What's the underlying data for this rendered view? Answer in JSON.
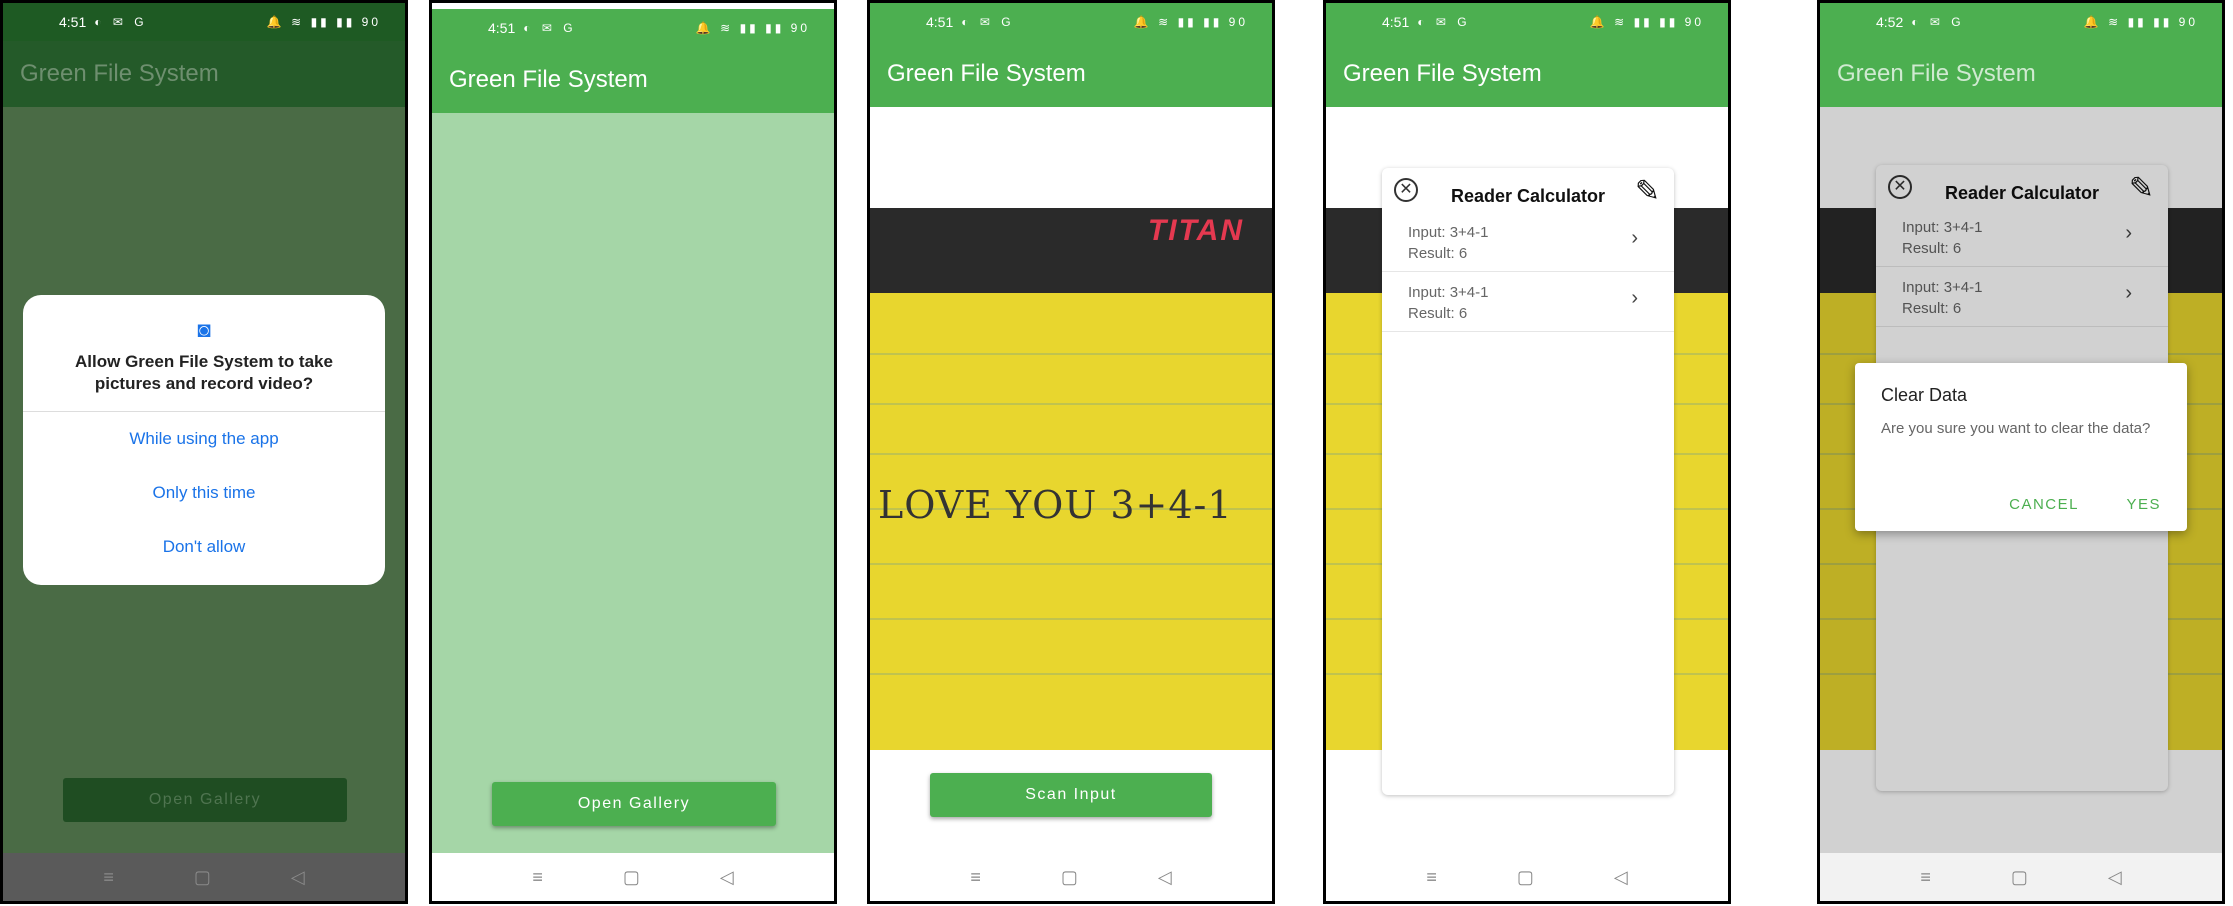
{
  "app_title": "Green File System",
  "screens": [
    {
      "status": {
        "time": "4:51",
        "icons": "◐ ✉ G",
        "right": "🔔 ≋ ▮▮ ▮▮ 90"
      },
      "permission": {
        "question": "Allow Green File System to take pictures and record video?",
        "options": [
          "While using the app",
          "Only this time",
          "Don't allow"
        ]
      },
      "button_label": "Open Gallery"
    },
    {
      "status": {
        "time": "4:51",
        "icons": "◐ ✉ G",
        "right": "🔔 ≋ ▮▮ ▮▮ 90"
      },
      "button_label": "Open Gallery"
    },
    {
      "status": {
        "time": "4:51",
        "icons": "◐ ✉ G",
        "right": "🔔 ≋ ▮▮ ▮▮ 90"
      },
      "photo": {
        "brand": "TITAN",
        "handwriting": "LOVE YOU 3+4-1"
      },
      "button_label": "Scan Input"
    },
    {
      "status": {
        "time": "4:51",
        "icons": "◐ ✉ G",
        "right": "🔔 ≋ ▮▮ ▮▮ 90"
      },
      "sheet": {
        "title": "Reader Calculator",
        "rows": [
          {
            "input": "Input: 3+4-1",
            "result": "Result: 6"
          },
          {
            "input": "Input: 3+4-1",
            "result": "Result: 6"
          }
        ]
      }
    },
    {
      "status": {
        "time": "4:52",
        "icons": "◐ ✉ G",
        "right": "🔔 ≋ ▮▮ ▮▮ 90"
      },
      "sheet": {
        "title": "Reader Calculator",
        "rows": [
          {
            "input": "Input: 3+4-1",
            "result": "Result: 6"
          },
          {
            "input": "Input: 3+4-1",
            "result": "Result: 6"
          }
        ]
      },
      "dialog": {
        "title": "Clear Data",
        "message": "Are you sure you want to clear the data?",
        "cancel": "CANCEL",
        "confirm": "YES"
      }
    }
  ],
  "nav": {
    "menu": "≡",
    "home": "▢",
    "back": "◁"
  },
  "icons": {
    "camera": "camera-icon",
    "close": "close-circle-icon",
    "edit": "edit-icon",
    "chevron": "chevron-right-icon"
  },
  "colors": {
    "primary": "#4caf50",
    "light_green": "#a5d6a7",
    "link_blue": "#1a73e8"
  }
}
